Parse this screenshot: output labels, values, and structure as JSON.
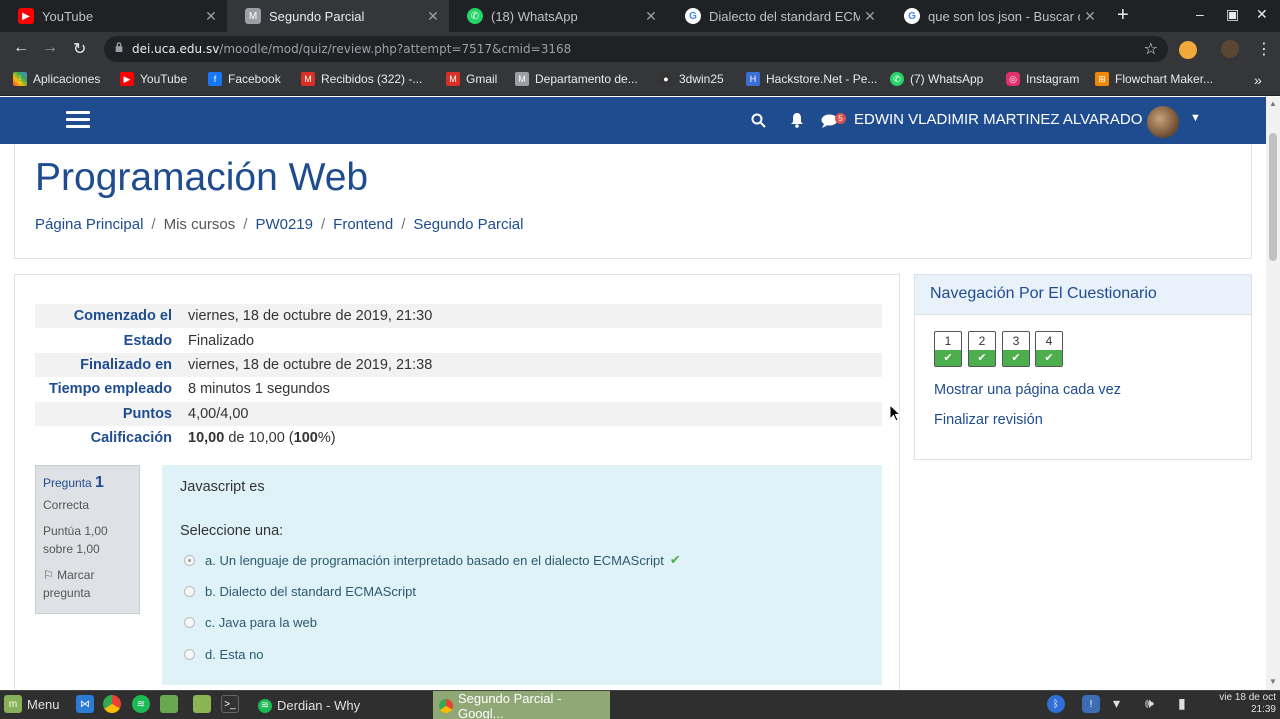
{
  "browser": {
    "tabs": [
      {
        "title": "YouTube",
        "icon": "youtube-icon",
        "color": "#ff0000",
        "active": false
      },
      {
        "title": "Segundo Parcial",
        "icon": "moodle-icon",
        "color": "#9aa0a6",
        "active": true
      },
      {
        "title": "(18) WhatsApp",
        "icon": "whatsapp-icon",
        "color": "#25d366",
        "active": false
      },
      {
        "title": "Dialecto del standard ECMAS",
        "icon": "google-icon",
        "color": "#4285f4",
        "active": false
      },
      {
        "title": "que son los json - Buscar co",
        "icon": "google-icon",
        "color": "#4285f4",
        "active": false
      }
    ],
    "url_host": "dei.uca.edu.sv",
    "url_path": "/moodle/mod/quiz/review.php?attempt=7517&cmid=3168",
    "bookmarks": [
      {
        "label": "Aplicaciones",
        "icon": "apps-icon",
        "color": "#e8453c"
      },
      {
        "label": "YouTube",
        "icon": "youtube-icon",
        "color": "#ff0000"
      },
      {
        "label": "Facebook",
        "icon": "facebook-icon",
        "color": "#1877f2"
      },
      {
        "label": "Recibidos (322) -...",
        "icon": "gmail-icon",
        "color": "#d93025"
      },
      {
        "label": "Gmail",
        "icon": "gmail-icon",
        "color": "#d93025"
      },
      {
        "label": "Departamento de...",
        "icon": "moodle-icon",
        "color": "#9aa0a6"
      },
      {
        "label": "3dwin25",
        "icon": "github-icon",
        "color": "#333333"
      },
      {
        "label": "Hackstore.Net - Pe...",
        "icon": "hackstore-icon",
        "color": "#3b6fd4"
      },
      {
        "label": "(7) WhatsApp",
        "icon": "whatsapp-icon",
        "color": "#25d366"
      },
      {
        "label": "Instagram",
        "icon": "instagram-icon",
        "color": "#e1306c"
      },
      {
        "label": "Flowchart Maker...",
        "icon": "flowchart-icon",
        "color": "#f08705"
      }
    ]
  },
  "navbar": {
    "username": "EDWIN VLADIMIR MARTINEZ ALVARADO",
    "message_count": "5"
  },
  "page": {
    "title": "Programación Web",
    "breadcrumb": [
      {
        "label": "Página Principal",
        "link": true
      },
      {
        "label": "Mis cursos",
        "link": false
      },
      {
        "label": "PW0219",
        "link": true
      },
      {
        "label": "Frontend",
        "link": true
      },
      {
        "label": "Segundo Parcial",
        "link": true
      }
    ]
  },
  "summary": [
    {
      "label": "Comenzado el",
      "value": "viernes, 18 de octubre de 2019, 21:30"
    },
    {
      "label": "Estado",
      "value": "Finalizado"
    },
    {
      "label": "Finalizado en",
      "value": "viernes, 18 de octubre de 2019, 21:38"
    },
    {
      "label": "Tiempo empleado",
      "value": "8 minutos 1 segundos"
    },
    {
      "label": "Puntos",
      "value": "4,00/4,00"
    },
    {
      "label": "Calificación",
      "grade": "10,00",
      "mid": " de 10,00 (",
      "pct": "100",
      "end": "%)"
    }
  ],
  "question": {
    "prefix": "Pregunta",
    "number": "1",
    "status": "Correcta",
    "score_line1": "Puntúa 1,00",
    "score_line2": "sobre 1,00",
    "flag_line1": "Marcar",
    "flag_line2": "pregunta",
    "text": "Javascript es",
    "prompt": "Seleccione una:",
    "options": [
      {
        "label": "a. Un lenguaje de programación interpretado basado en el dialecto ECMAScript",
        "selected": true,
        "correct": true
      },
      {
        "label": "b. Dialecto del standard ECMAScript",
        "selected": false,
        "correct": false
      },
      {
        "label": "c. Java para la web",
        "selected": false,
        "correct": false
      },
      {
        "label": "d. Esta no",
        "selected": false,
        "correct": false
      }
    ]
  },
  "quiz_nav": {
    "title": "Navegación Por El Cuestionario",
    "buttons": [
      "1",
      "2",
      "3",
      "4"
    ],
    "link_one_page": "Mostrar una página cada vez",
    "link_finish": "Finalizar revisión"
  },
  "taskbar": {
    "menu": "Menu",
    "tasks": [
      {
        "label": "Derdian - Why",
        "active": false
      },
      {
        "label": "Segundo Parcial - Googl...",
        "active": true
      }
    ],
    "clock_line1": "vie 18 de oct",
    "clock_line2": "21:39"
  },
  "colors": {
    "moodle_blue": "#1f4c8f",
    "correct_green": "#4cae4c",
    "question_bg": "#def2f8"
  }
}
